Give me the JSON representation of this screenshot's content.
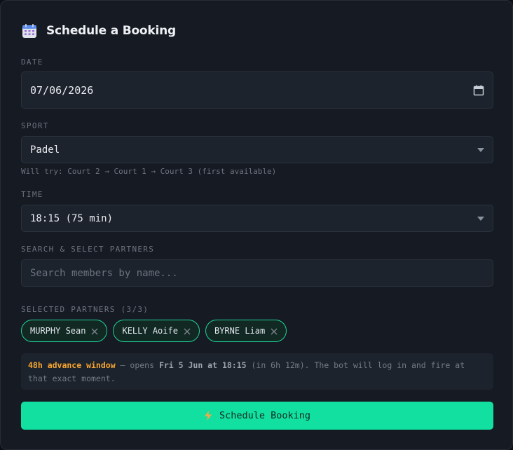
{
  "header": {
    "title": "Schedule a Booking",
    "icon": "calendar-icon"
  },
  "date": {
    "label": "DATE",
    "value": "07/06/2026",
    "icon": "calendar-picker-icon"
  },
  "sport": {
    "label": "SPORT",
    "value": "Padel",
    "hint": "Will try: Court 2 → Court 1 → Court 3 (first available)"
  },
  "time": {
    "label": "TIME",
    "value": "18:15 (75 min)"
  },
  "search": {
    "label": "SEARCH & SELECT PARTNERS",
    "placeholder": "Search members by name..."
  },
  "partners": {
    "label": "SELECTED PARTNERS (3/3)",
    "items": [
      {
        "name": "MURPHY Sean"
      },
      {
        "name": "KELLY Aoife"
      },
      {
        "name": "BYRNE Liam"
      }
    ]
  },
  "notice": {
    "highlight": "48h advance window",
    "dash": " — opens ",
    "opens_at": "Fri 5 Jun at 18:15",
    "rest": " (in 6h 12m). The bot will log in and fire at that exact moment."
  },
  "submit": {
    "icon": "lightning-icon",
    "label": "Schedule Booking"
  },
  "colors": {
    "accent": "#12e0a0",
    "chip_border": "#1fd39a",
    "warning": "#f7a531",
    "background": "#161a22"
  }
}
